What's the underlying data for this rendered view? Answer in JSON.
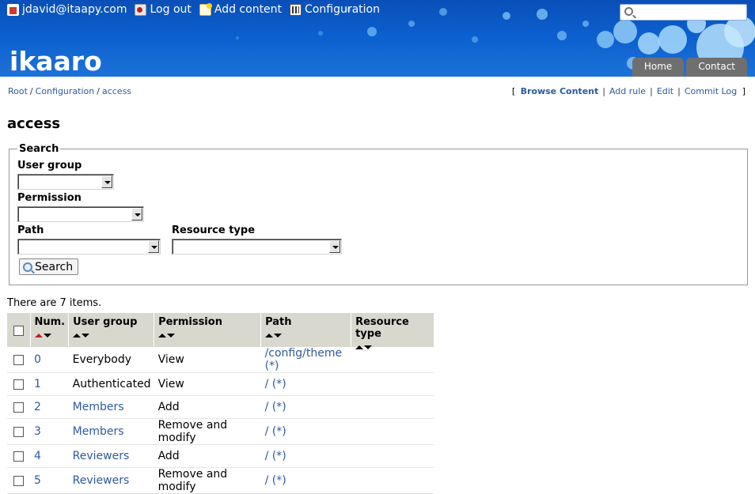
{
  "userbar": {
    "user": "jdavid@itaapy.com",
    "logout": "Log out",
    "add_content": "Add content",
    "configuration": "Configuration"
  },
  "logo": "ikaaro",
  "search_box": {
    "value": ""
  },
  "top_tabs": [
    "Home",
    "Contact"
  ],
  "breadcrumb": [
    "Root",
    "Configuration",
    "access"
  ],
  "actions": [
    "Browse Content",
    "Add rule",
    "Edit",
    "Commit Log"
  ],
  "page_title": "access",
  "search_form": {
    "legend": "Search",
    "user_group_label": "User group",
    "permission_label": "Permission",
    "path_label": "Path",
    "resource_type_label": "Resource type",
    "button_label": "Search"
  },
  "count_text": "There are 7 items.",
  "table": {
    "headers": [
      "Num.",
      "User group",
      "Permission",
      "Path",
      "Resource type"
    ],
    "rows": [
      {
        "num": "0",
        "group": "Everybody",
        "permission": "View",
        "path": "/config/theme (*)",
        "type": ""
      },
      {
        "num": "1",
        "group": "Authenticated",
        "permission": "View",
        "path": "/ (*)",
        "type": ""
      },
      {
        "num": "2",
        "group": "Members",
        "permission": "Add",
        "path": "/ (*)",
        "type": ""
      },
      {
        "num": "3",
        "group": "Members",
        "permission": "Remove and modify",
        "path": "/ (*)",
        "type": ""
      },
      {
        "num": "4",
        "group": "Reviewers",
        "permission": "Add",
        "path": "/ (*)",
        "type": ""
      },
      {
        "num": "5",
        "group": "Reviewers",
        "permission": "Remove and modify",
        "path": "/ (*)",
        "type": ""
      }
    ]
  },
  "colors": {
    "header_blue": "#0b5fce",
    "link": "#2c5aa0",
    "tab_gray": "#6f6f6f",
    "table_header": "#d8d8cf",
    "sort_active": "#c02020"
  }
}
